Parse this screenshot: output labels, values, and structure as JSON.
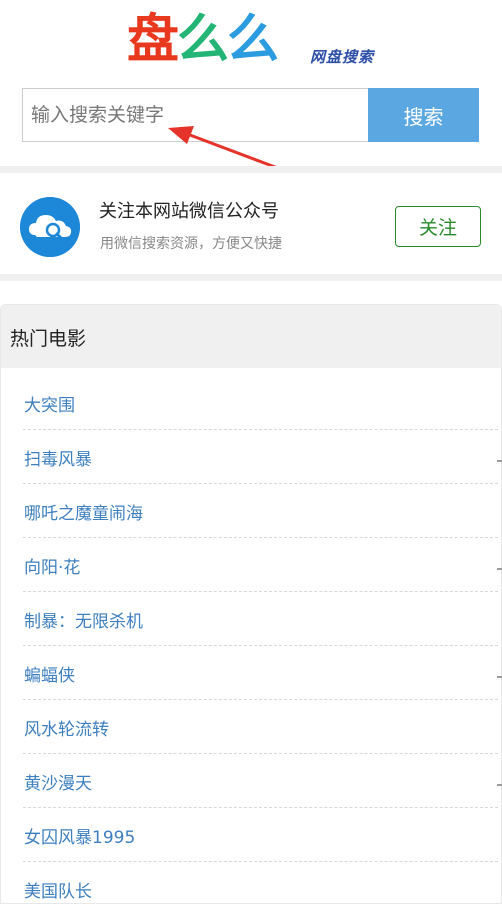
{
  "header": {
    "logo_part1": "盘",
    "logo_part2": "么",
    "logo_part3": "么",
    "logo_tagline": "网盘搜索"
  },
  "search": {
    "placeholder": "输入搜索关键字",
    "button_label": "搜索"
  },
  "follow": {
    "title": "关注本网站微信公众号",
    "subtitle": "用微信搜索资源，方便又快捷",
    "button_label": "关注"
  },
  "hot_movies": {
    "heading": "热门电影",
    "items": [
      {
        "title": "大突围"
      },
      {
        "title": "扫毒风暴"
      },
      {
        "title": "哪吒之魔童闹海"
      },
      {
        "title": "向阳·花"
      },
      {
        "title": "制暴：无限杀机"
      },
      {
        "title": "蝙蝠侠"
      },
      {
        "title": "风水轮流转"
      },
      {
        "title": "黄沙漫天"
      },
      {
        "title": "女囚风暴1995"
      },
      {
        "title": "美国队长"
      }
    ]
  },
  "colors": {
    "logo_red": "#e8391f",
    "logo_green": "#23b575",
    "logo_blue": "#2c9ce0",
    "search_button": "#5aa7e2",
    "follow_green": "#2a8a2a",
    "link_blue": "#3d7fbf",
    "annotation_arrow": "#e53329"
  }
}
